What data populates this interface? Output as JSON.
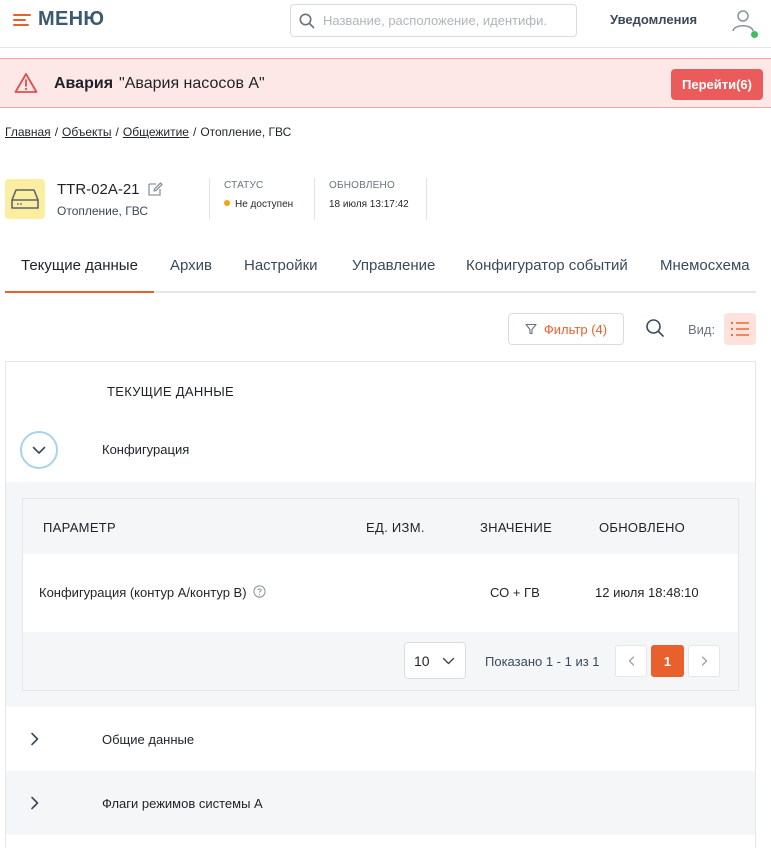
{
  "header": {
    "menu_label": "МЕНЮ",
    "search_placeholder": "Название, расположение, идентифи.",
    "notifications_label": "Уведомления",
    "user_status_color": "#3fbf5a"
  },
  "alarm": {
    "kind": "Авария",
    "message": "\"Авария насосов А\"",
    "button_label": "Перейти(6)",
    "icon": "warning-triangle-icon"
  },
  "breadcrumb": {
    "items": [
      "Главная",
      "Объекты",
      "Общежитие"
    ],
    "current": "Отопление, ГВС",
    "separator": "/"
  },
  "device": {
    "name": "TTR-02A-21",
    "subtitle": "Отопление, ГВС",
    "status_label": "СТАТУС",
    "status_value": "Не доступен",
    "updated_label": "ОБНОВЛЕНО",
    "updated_value": "18 июля 13:17:42"
  },
  "tabs": [
    {
      "label": "Текущие данные",
      "active": true
    },
    {
      "label": "Архив",
      "active": false
    },
    {
      "label": "Настройки",
      "active": false
    },
    {
      "label": "Управление",
      "active": false
    },
    {
      "label": "Конфигуратор событий",
      "active": false
    },
    {
      "label": "Мнемосхема",
      "active": false
    }
  ],
  "toolbar": {
    "filter_label": "Фильтр (4)",
    "view_label": "Вид:"
  },
  "current_data": {
    "title": "ТЕКУЩИЕ ДАННЫЕ",
    "expanded_section": "Конфигурация",
    "table": {
      "columns": [
        "ПАРАМЕТР",
        "ЕД. ИЗМ.",
        "ЗНАЧЕНИЕ",
        "ОБНОВЛЕНО"
      ],
      "rows": [
        {
          "param": "Конфигурация (контур А/контур В)",
          "unit": "",
          "value": "СО + ГВ",
          "updated": "12 июля 18:48:10"
        }
      ]
    },
    "pagination": {
      "page_size": "10",
      "info": "Показано 1 - 1 из 1",
      "current_page": "1"
    },
    "sections": [
      "Общие данные",
      "Флаги режимов системы А"
    ]
  },
  "colors": {
    "accent": "#e8612c",
    "alarm_bg": "#fde7e7",
    "alarm_button": "#ea5b5b",
    "status_unavailable": "#f2a516"
  }
}
